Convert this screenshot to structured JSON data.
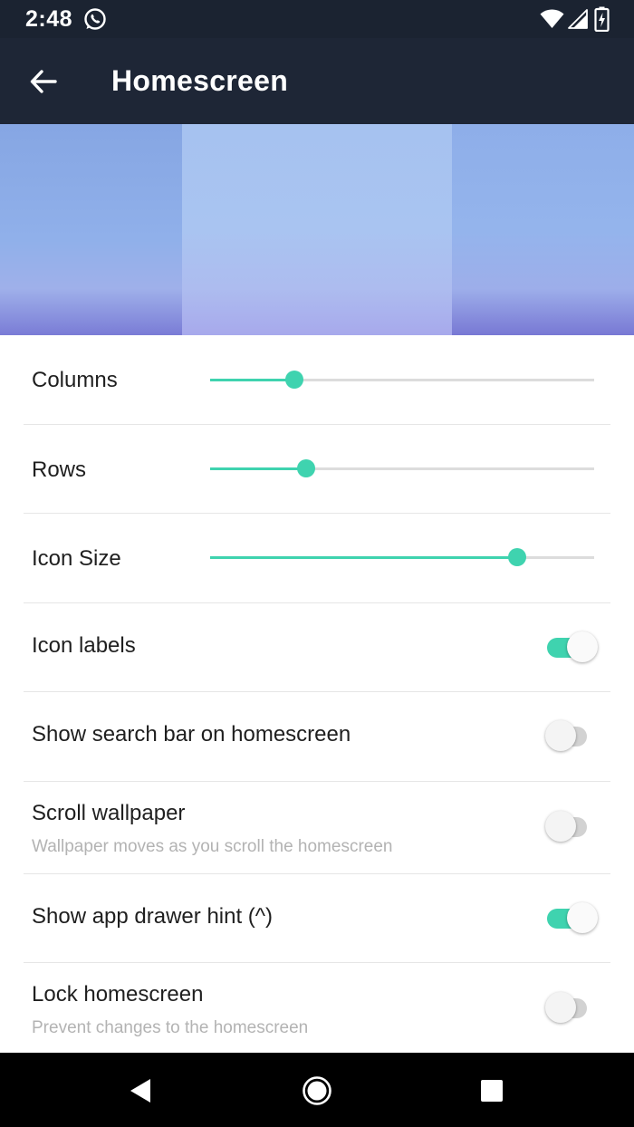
{
  "status_bar": {
    "time": "2:48",
    "icons": [
      "whatsapp-icon",
      "wifi-icon",
      "signal-icon",
      "battery-charging-icon"
    ]
  },
  "app_bar": {
    "title": "Homescreen",
    "back_icon": "arrow-left-icon"
  },
  "colors": {
    "accent": "#3fd3af",
    "app_bar": "#1e2636",
    "status_bar": "#1b2331",
    "text_primary": "#1f1f1f",
    "text_secondary": "#b3b3b3"
  },
  "settings": {
    "columns": {
      "label": "Columns",
      "value": 0.22
    },
    "rows": {
      "label": "Rows",
      "value": 0.25
    },
    "icon_size": {
      "label": "Icon Size",
      "value": 0.8
    },
    "icon_labels": {
      "label": "Icon labels",
      "enabled": true
    },
    "search_bar": {
      "label": "Show search bar on homescreen",
      "enabled": false
    },
    "scroll_wallpaper": {
      "label": "Scroll wallpaper",
      "description": "Wallpaper moves as you scroll the homescreen",
      "enabled": false
    },
    "drawer_hint": {
      "label": "Show app drawer hint (^)",
      "enabled": true
    },
    "lock_homescreen": {
      "label": "Lock homescreen",
      "description": "Prevent changes to the homescreen",
      "enabled": false
    }
  },
  "nav_bar": {
    "icons": [
      "back-triangle-icon",
      "home-circle-icon",
      "recents-square-icon"
    ]
  }
}
